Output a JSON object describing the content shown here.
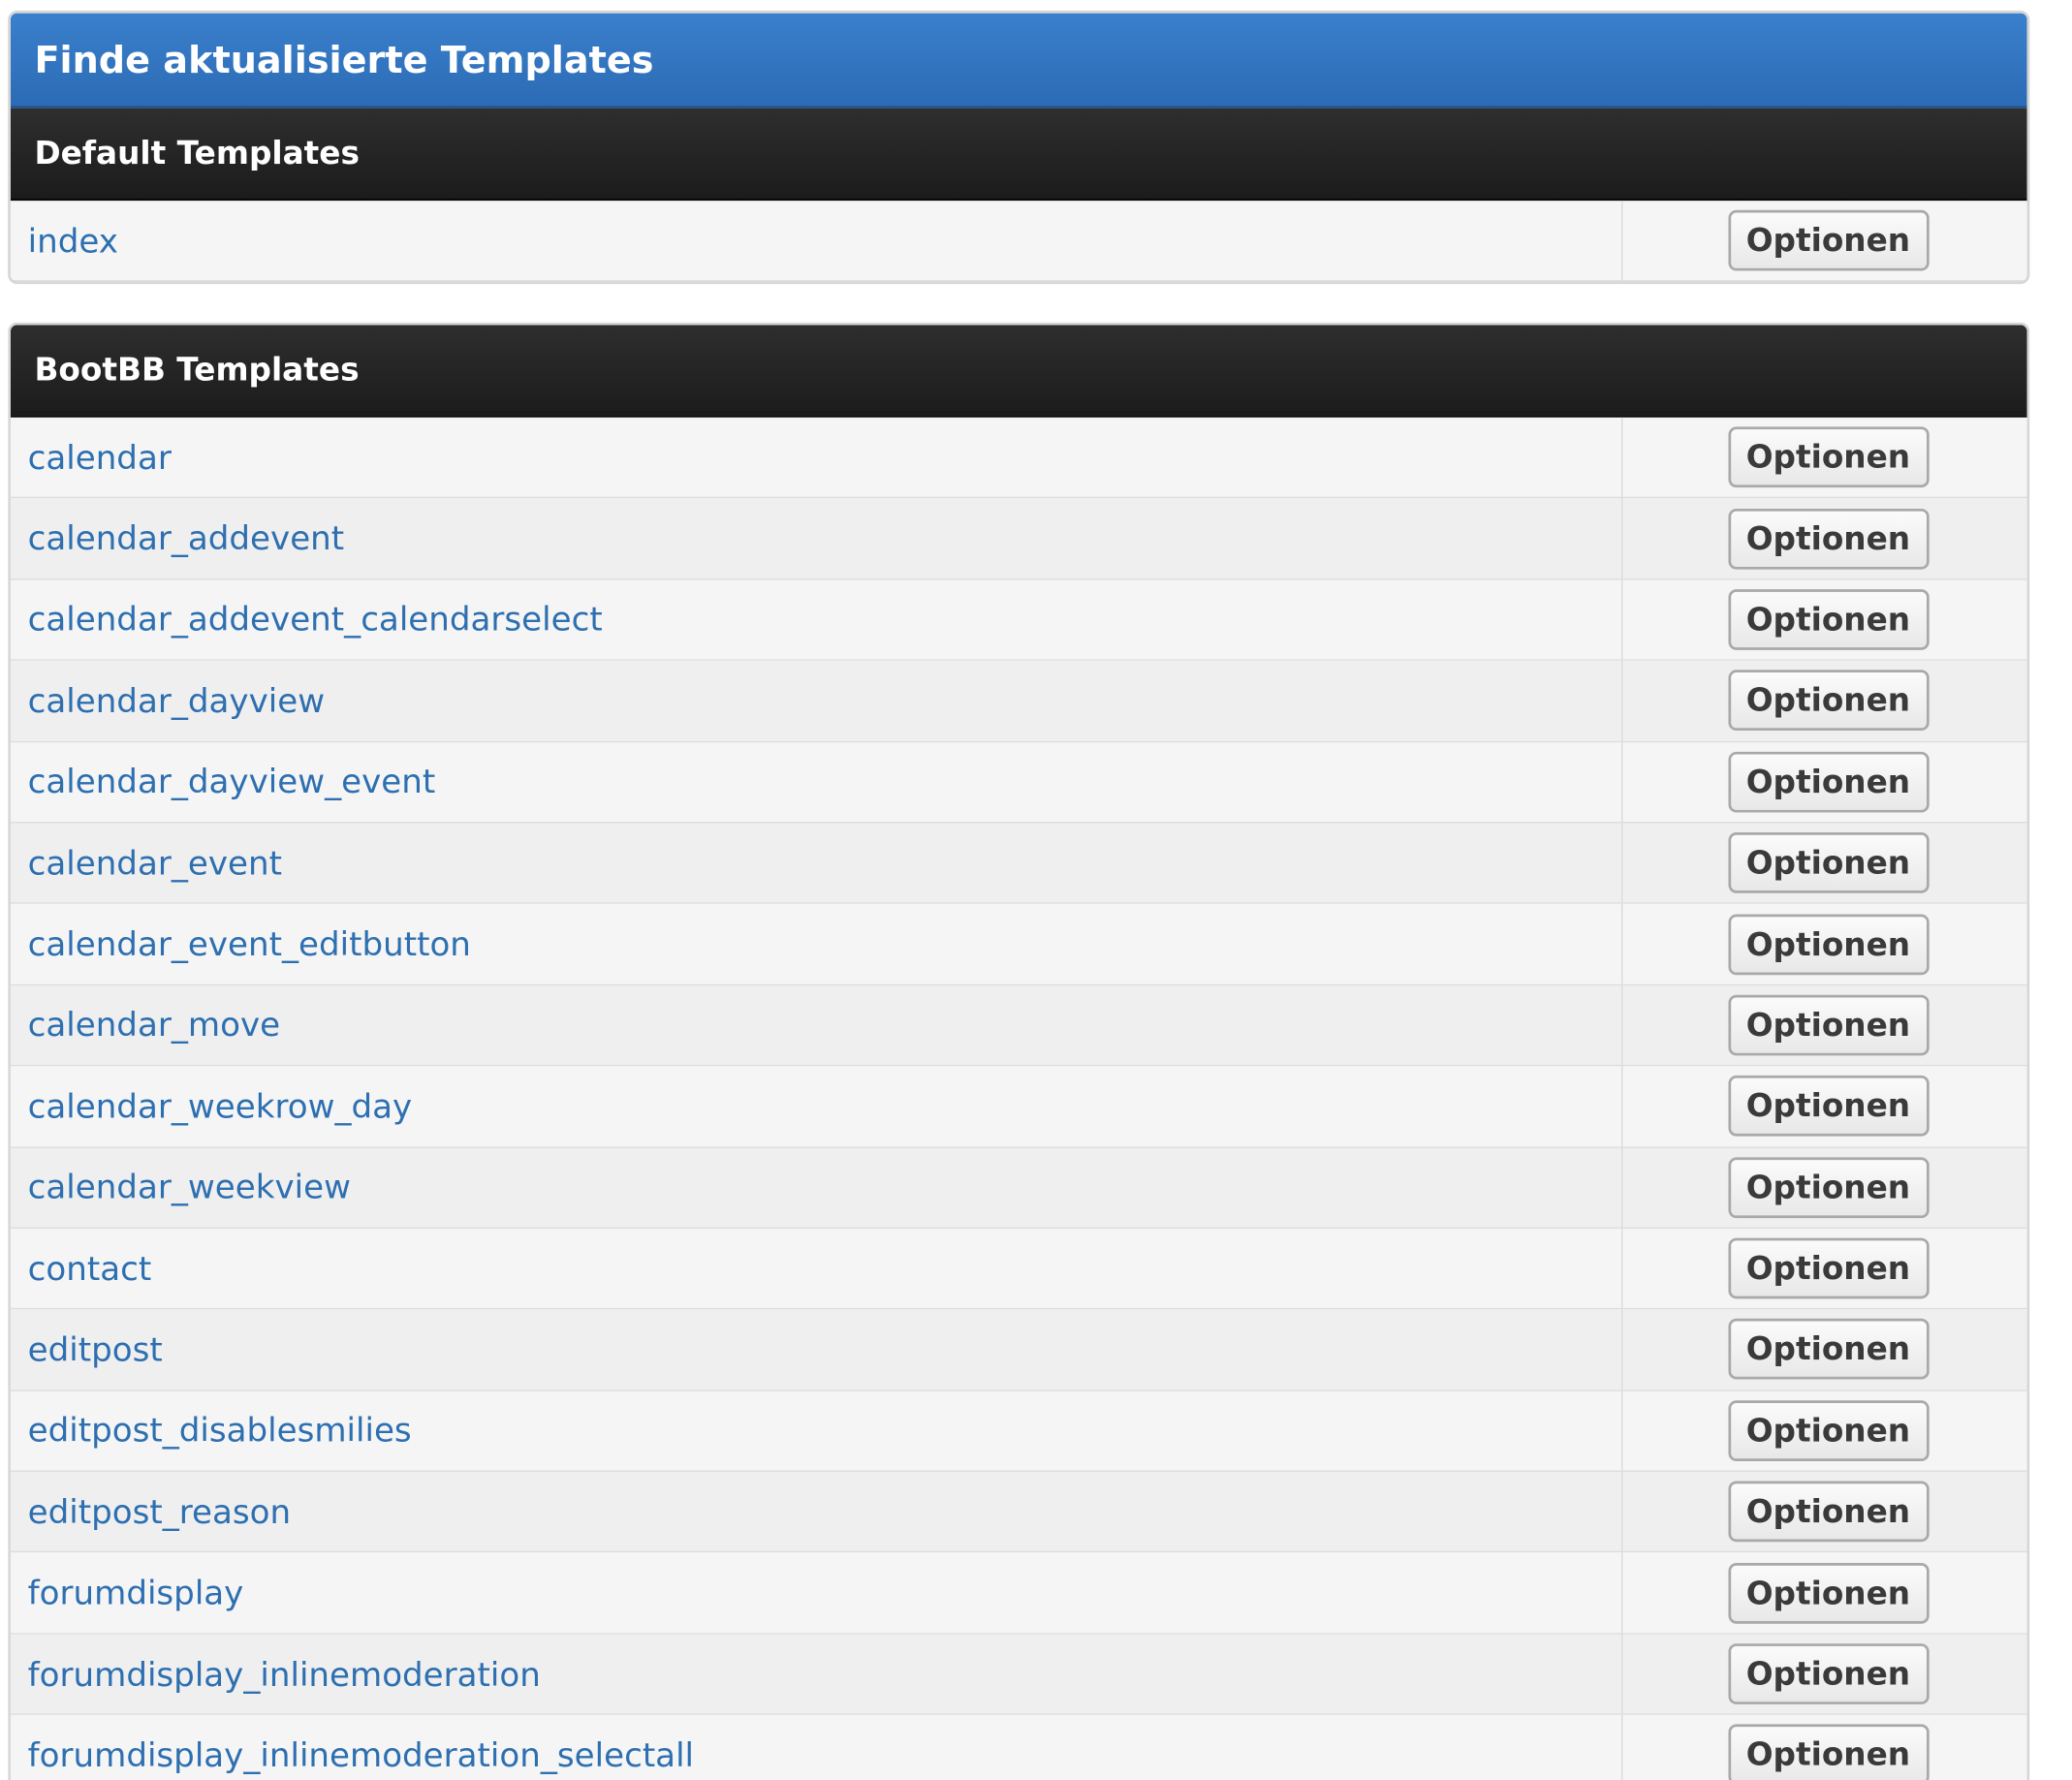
{
  "page": {
    "title": "Finde aktualisierte Templates"
  },
  "sections": [
    {
      "heading": "Default Templates",
      "rows": [
        {
          "name": "index",
          "button": "Optionen"
        }
      ]
    },
    {
      "heading": "BootBB Templates",
      "rows": [
        {
          "name": "calendar",
          "button": "Optionen"
        },
        {
          "name": "calendar_addevent",
          "button": "Optionen"
        },
        {
          "name": "calendar_addevent_calendarselect",
          "button": "Optionen"
        },
        {
          "name": "calendar_dayview",
          "button": "Optionen"
        },
        {
          "name": "calendar_dayview_event",
          "button": "Optionen"
        },
        {
          "name": "calendar_event",
          "button": "Optionen"
        },
        {
          "name": "calendar_event_editbutton",
          "button": "Optionen"
        },
        {
          "name": "calendar_move",
          "button": "Optionen"
        },
        {
          "name": "calendar_weekrow_day",
          "button": "Optionen"
        },
        {
          "name": "calendar_weekview",
          "button": "Optionen"
        },
        {
          "name": "contact",
          "button": "Optionen"
        },
        {
          "name": "editpost",
          "button": "Optionen"
        },
        {
          "name": "editpost_disablesmilies",
          "button": "Optionen"
        },
        {
          "name": "editpost_reason",
          "button": "Optionen"
        },
        {
          "name": "forumdisplay",
          "button": "Optionen"
        },
        {
          "name": "forumdisplay_inlinemoderation",
          "button": "Optionen"
        },
        {
          "name": "forumdisplay_inlinemoderation_selectall",
          "button": "Optionen"
        }
      ]
    }
  ]
}
